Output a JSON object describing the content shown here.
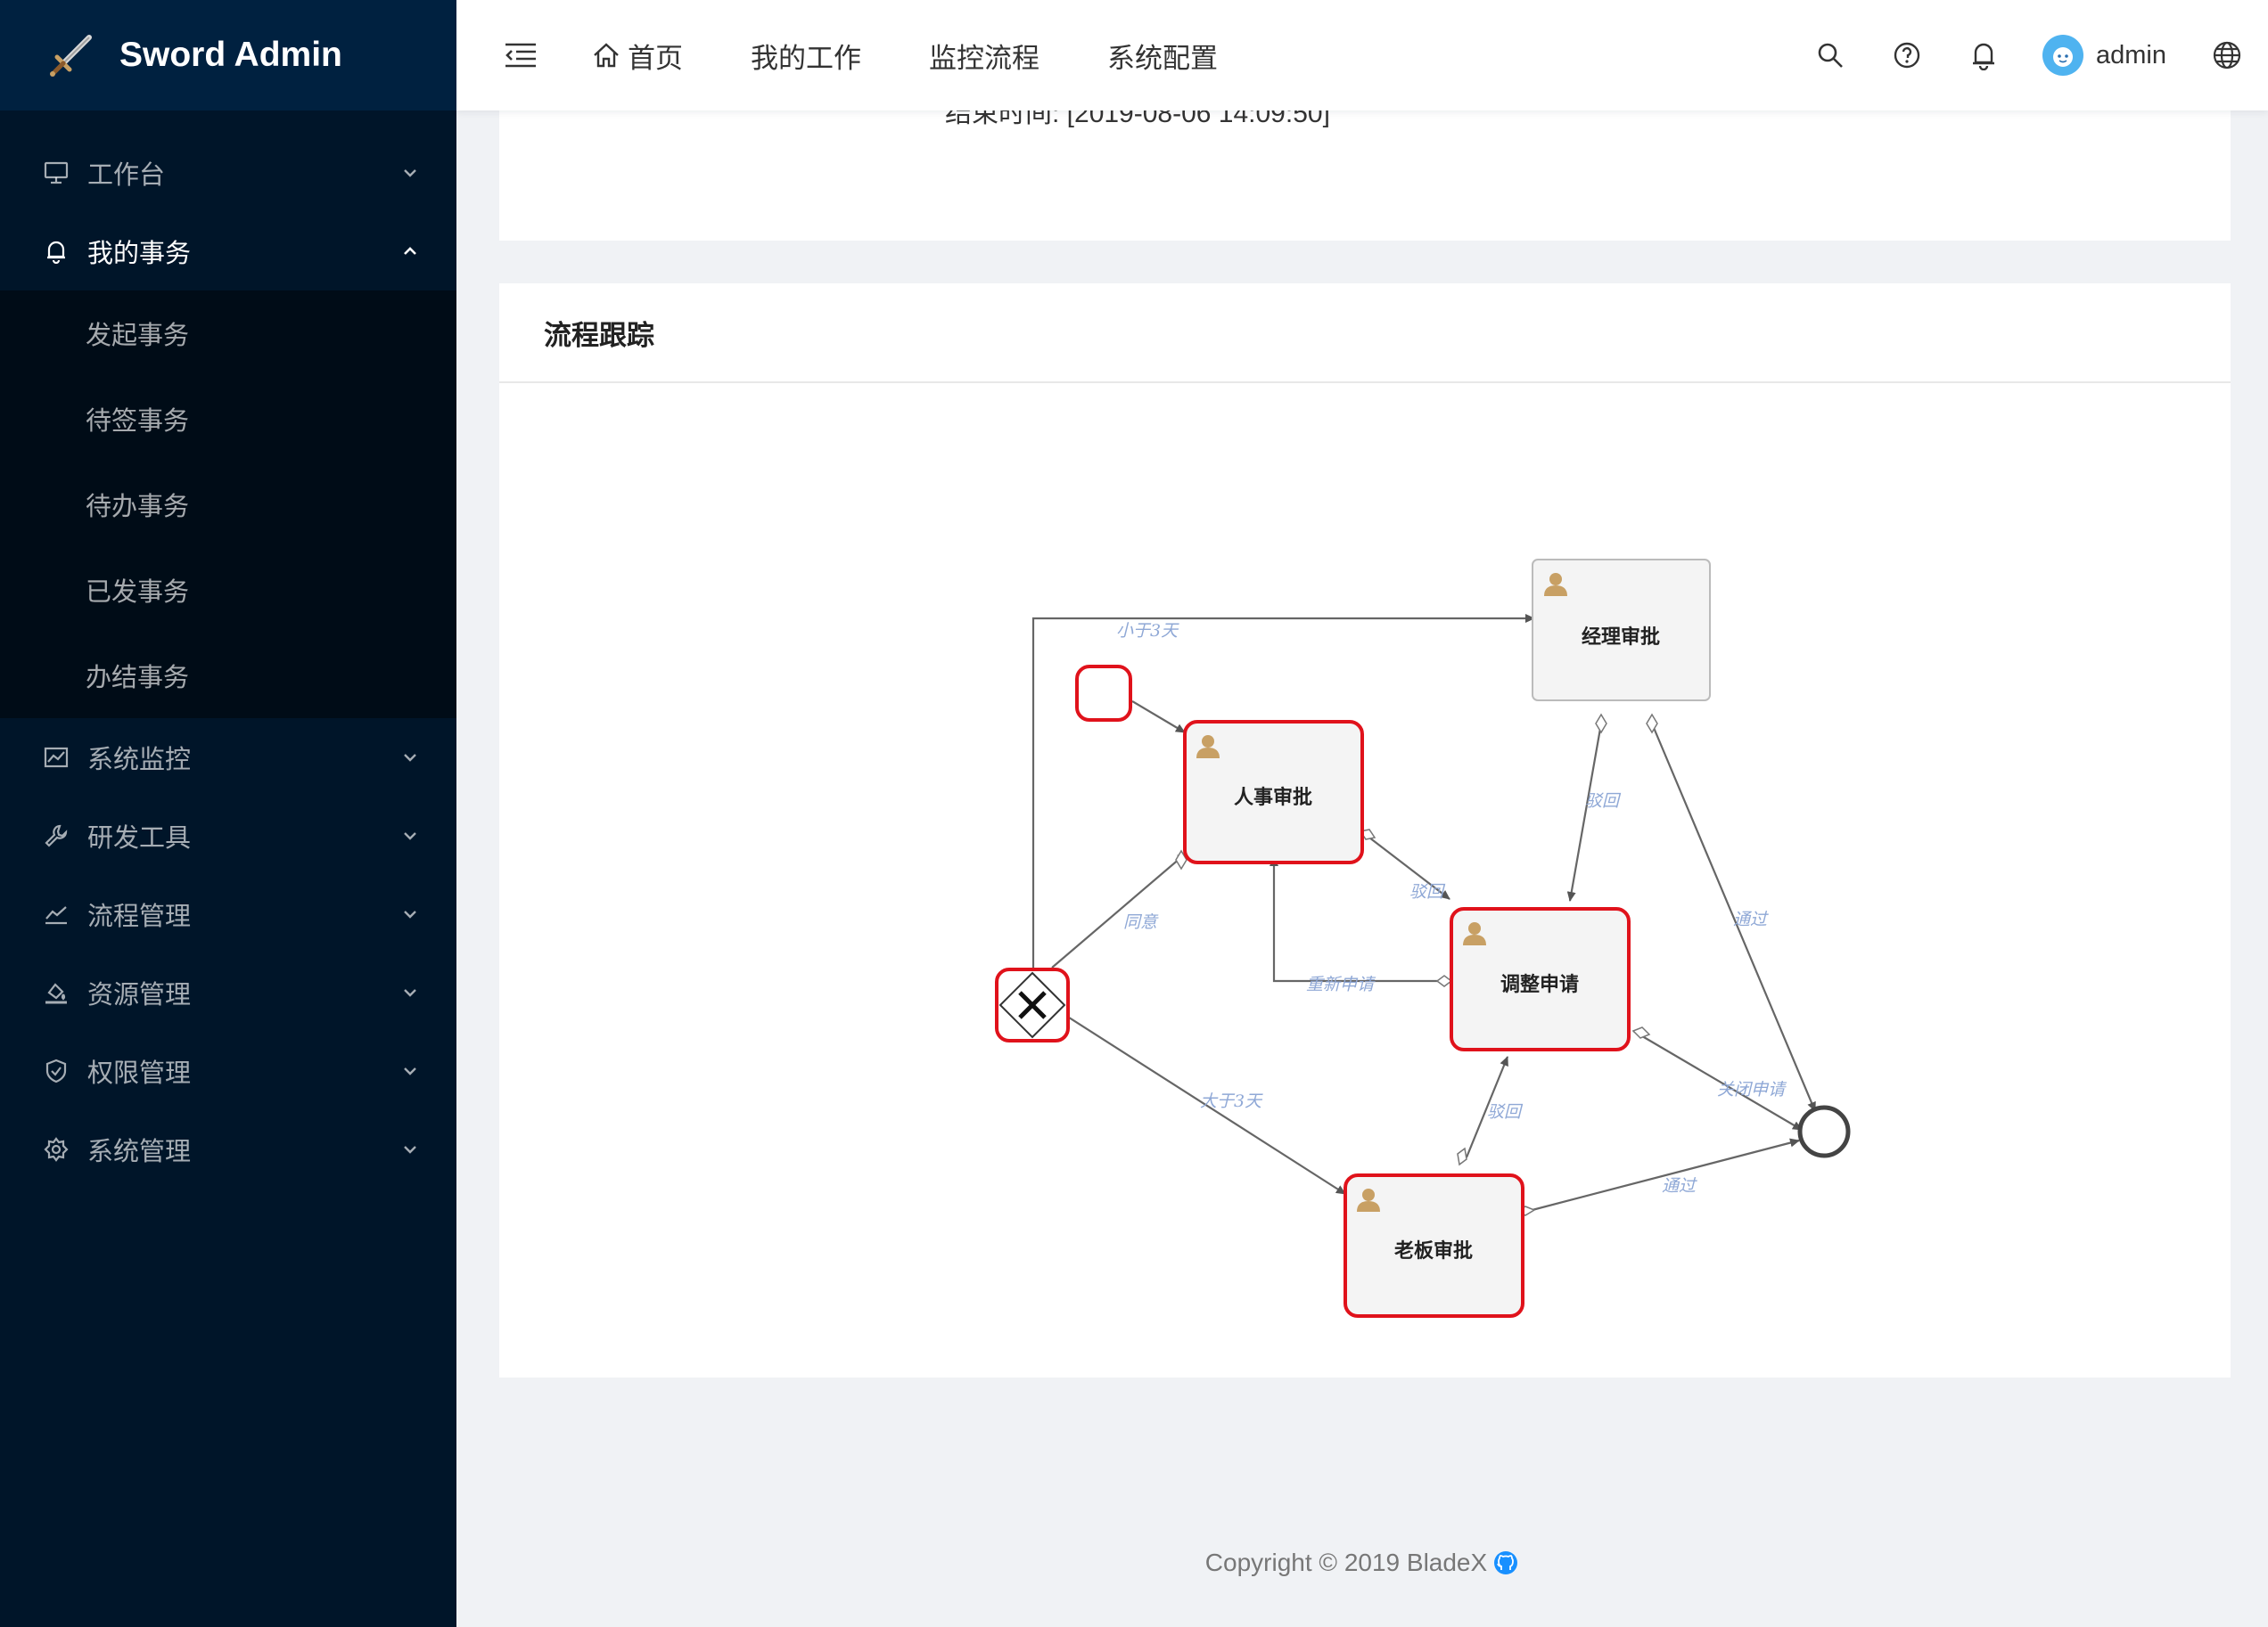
{
  "app": {
    "title": "Sword Admin"
  },
  "sidebar": {
    "items": [
      {
        "label": "工作台",
        "icon": "desktop-icon"
      },
      {
        "label": "我的事务",
        "icon": "bell-icon",
        "open": true,
        "children": [
          "发起事务",
          "待签事务",
          "待办事务",
          "已发事务",
          "办结事务"
        ]
      },
      {
        "label": "系统监控",
        "icon": "area-chart-icon"
      },
      {
        "label": "研发工具",
        "icon": "tool-icon"
      },
      {
        "label": "流程管理",
        "icon": "stock-icon"
      },
      {
        "label": "资源管理",
        "icon": "bg-colors-icon"
      },
      {
        "label": "权限管理",
        "icon": "safety-icon"
      },
      {
        "label": "系统管理",
        "icon": "setting-icon"
      }
    ]
  },
  "header": {
    "nav": [
      "首页",
      "我的工作",
      "监控流程",
      "系统配置"
    ],
    "username": "admin"
  },
  "top_card": {
    "end_time": "结束时间: [2019-08-06 14:09:50]"
  },
  "process_card": {
    "title": "流程跟踪",
    "nodes": {
      "manager": "经理审批",
      "hr": "人事审批",
      "adjust": "调整申请",
      "boss": "老板审批"
    },
    "flows": {
      "less3": "小于3天",
      "reject1": "驳回",
      "approve1": "通过",
      "reject2": "驳回",
      "agree": "同意",
      "reapply": "重新申请",
      "greater3": "大于3天",
      "close": "关闭申请",
      "reject3": "驳回",
      "approve2": "通过"
    },
    "colors": {
      "active": "#e0121b",
      "task_bg": "#f4f4f4",
      "edge": "#666666",
      "label": "#8fa8d6"
    }
  },
  "footer": {
    "copyright": "Copyright © 2019 BladeX"
  }
}
